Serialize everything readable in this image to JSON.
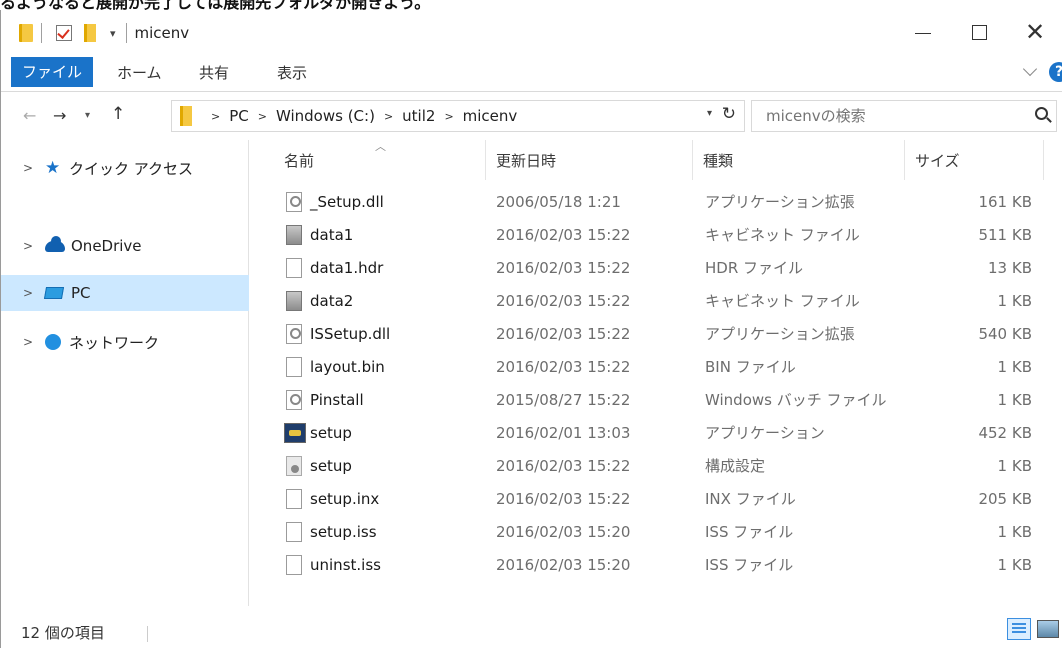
{
  "caption": "るようなると展開が完了しては展開先フォルダが開きよう。",
  "window": {
    "title": "micenv"
  },
  "ribbon": {
    "tabs": [
      "ファイル",
      "ホーム",
      "共有",
      "表示"
    ]
  },
  "address": {
    "breadcrumbs": [
      "PC",
      "Windows (C:)",
      "util2",
      "micenv"
    ],
    "search_placeholder": "micenvの検索"
  },
  "sidebar": {
    "items": [
      {
        "label": "クイック アクセス",
        "icon": "star-icon"
      },
      {
        "label": "OneDrive",
        "icon": "cloud-icon"
      },
      {
        "label": "PC",
        "icon": "pc-icon",
        "selected": true
      },
      {
        "label": "ネットワーク",
        "icon": "network-icon"
      }
    ]
  },
  "columns": {
    "name": "名前",
    "date": "更新日時",
    "type": "種類",
    "size": "サイズ"
  },
  "files": [
    {
      "name": "_Setup.dll",
      "date": "2006/05/18 1:21",
      "type": "アプリケーション拡張",
      "size": "161 KB",
      "icon": "dll-icon"
    },
    {
      "name": "data1",
      "date": "2016/02/03 15:22",
      "type": "キャビネット ファイル",
      "size": "511 KB",
      "icon": "cabinet-icon"
    },
    {
      "name": "data1.hdr",
      "date": "2016/02/03 15:22",
      "type": "HDR ファイル",
      "size": "13 KB",
      "icon": "file-icon"
    },
    {
      "name": "data2",
      "date": "2016/02/03 15:22",
      "type": "キャビネット ファイル",
      "size": "1 KB",
      "icon": "cabinet-icon"
    },
    {
      "name": "ISSetup.dll",
      "date": "2016/02/03 15:22",
      "type": "アプリケーション拡張",
      "size": "540 KB",
      "icon": "dll-icon"
    },
    {
      "name": "layout.bin",
      "date": "2016/02/03 15:22",
      "type": "BIN ファイル",
      "size": "1 KB",
      "icon": "file-icon"
    },
    {
      "name": "Pinstall",
      "date": "2015/08/27 15:22",
      "type": "Windows バッチ ファイル",
      "size": "1 KB",
      "icon": "batch-icon"
    },
    {
      "name": "setup",
      "date": "2016/02/01 13:03",
      "type": "アプリケーション",
      "size": "452 KB",
      "icon": "installer-icon"
    },
    {
      "name": "setup",
      "date": "2016/02/03 15:22",
      "type": "構成設定",
      "size": "1 KB",
      "icon": "settings-file-icon"
    },
    {
      "name": "setup.inx",
      "date": "2016/02/03 15:22",
      "type": "INX ファイル",
      "size": "205 KB",
      "icon": "file-icon"
    },
    {
      "name": "setup.iss",
      "date": "2016/02/03 15:20",
      "type": "ISS ファイル",
      "size": "1 KB",
      "icon": "file-icon"
    },
    {
      "name": "uninst.iss",
      "date": "2016/02/03 15:20",
      "type": "ISS ファイル",
      "size": "1 KB",
      "icon": "file-icon"
    }
  ],
  "status": {
    "item_count": "12 個の項目"
  },
  "colors": {
    "accent": "#1a73c9",
    "selection": "#cce8ff"
  }
}
